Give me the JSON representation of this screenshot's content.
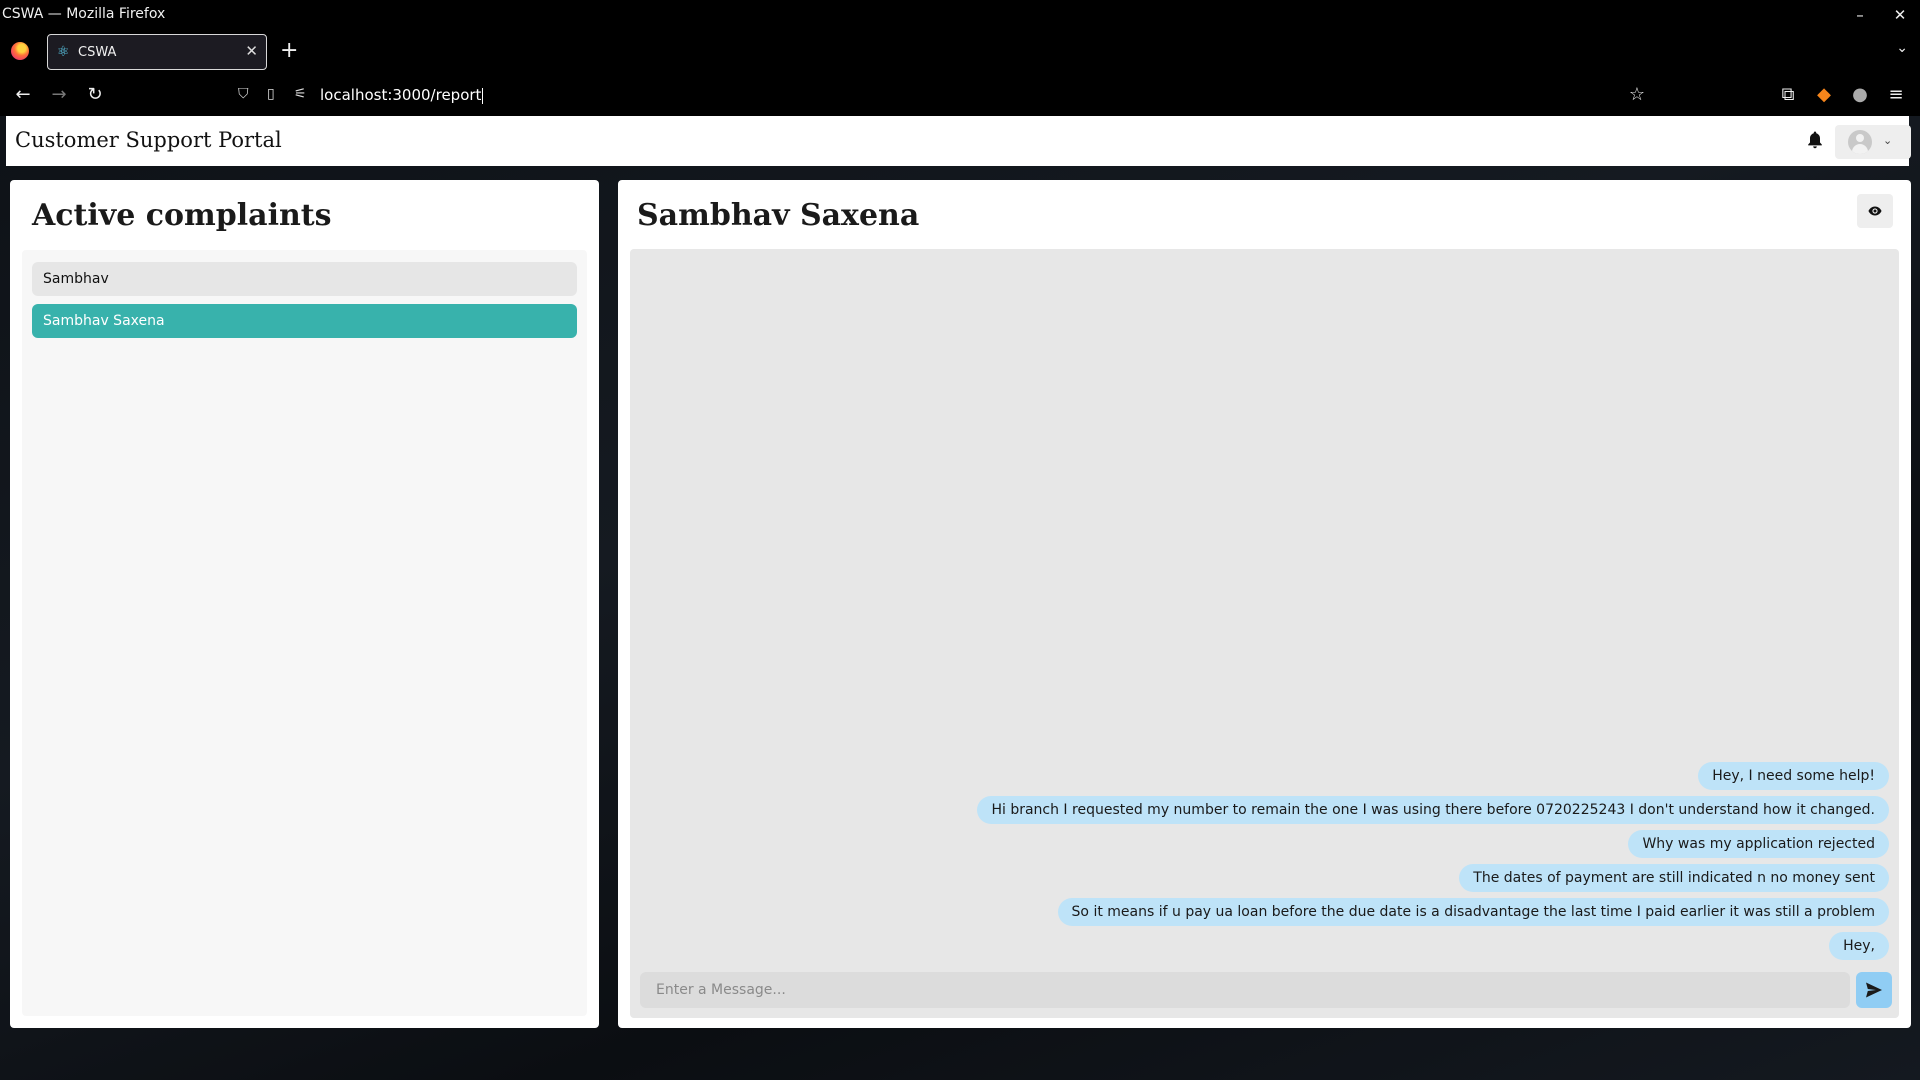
{
  "browser": {
    "window_title": "CSWA — Mozilla Firefox",
    "tab_title": "CSWA",
    "url": "localhost:3000/report",
    "window_controls": {
      "minimize": "–",
      "close": "✕"
    },
    "new_tab": "+"
  },
  "app": {
    "title": "Customer Support Portal",
    "icons": [
      "bell-icon",
      "avatar-icon",
      "chevron-down-icon",
      "eye-icon",
      "send-icon"
    ]
  },
  "complaints": {
    "heading": "Active complaints",
    "items": [
      {
        "label": "Sambhav",
        "selected": false
      },
      {
        "label": "Sambhav Saxena",
        "selected": true
      }
    ],
    "selected_color": "#38b2ac"
  },
  "chat": {
    "title": "Sambhav Saxena",
    "messages": [
      "Hey, I need some help!",
      "Hi branch I requested my number to remain the one I was using there before 0720225243 I don't understand how it changed.",
      "Why was my application rejected",
      "The dates of payment are still indicated n no money sent",
      "So it means if u pay ua loan before the due date is a disadvantage the last time I paid earlier it was still a problem",
      "Hey,"
    ],
    "message_bubble_color": "#bee3f8",
    "input_placeholder": "Enter a Message..."
  }
}
